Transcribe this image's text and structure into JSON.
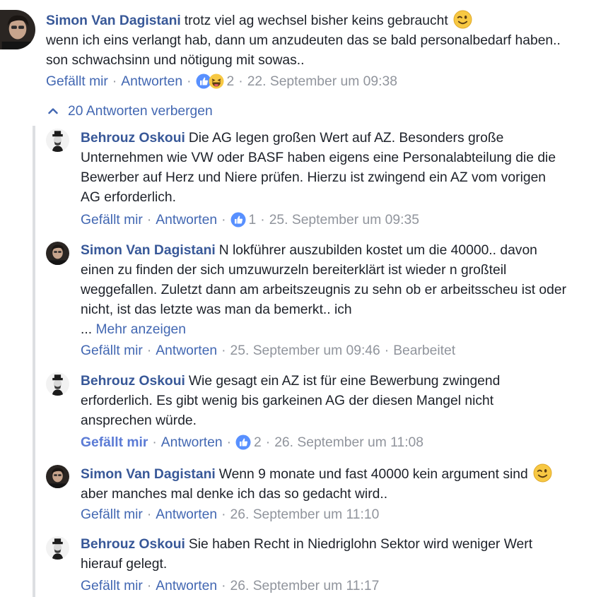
{
  "comments": [
    {
      "author": "Simon Van Dagistani",
      "text_part1": "trotz viel ag wechsel bisher keins gebraucht",
      "text_part2": "wenn ich eins verlangt hab, dann um anzudeuten das se bald personalbedarf haben.. son schwachsinn und nötigung mit sowas..",
      "like": "Gefällt mir",
      "reply": "Antworten",
      "reactions": "2",
      "time": "22. September um 09:38"
    }
  ],
  "toggle_replies": "20 Antworten verbergen",
  "replies": [
    {
      "author": "Behrouz Oskoui",
      "text": "Die AG legen großen Wert auf AZ. Besonders große Unternehmen wie VW oder BASF haben eigens eine Personalabteilung die die Bewerber auf Herz und Niere prüfen. Hierzu ist zwingend ein AZ vom vorigen AG erforderlich.",
      "like": "Gefällt mir",
      "reply": "Antworten",
      "reactions": "1",
      "time": "25. September um 09:35"
    },
    {
      "author": "Simon Van Dagistani",
      "text": "N lokführer auszubilden kostet um die 40000.. davon einen zu finden der sich umzuwurzeln bereiterklärt ist wieder n großteil weggefallen. Zuletzt dann am arbeitszeugnis zu sehn ob er arbeitsscheu ist oder nicht, ist das letzte was man da bemerkt.. ich",
      "ellipsis": "...",
      "more": "Mehr anzeigen",
      "like": "Gefällt mir",
      "reply": "Antworten",
      "time": "25. September um 09:46",
      "edited": "Bearbeitet"
    },
    {
      "author": "Behrouz Oskoui",
      "text": "Wie gesagt ein AZ ist für eine Bewerbung zwingend erforderlich. Es gibt wenig bis garkeinen AG der diesen Mangel nicht ansprechen würde.",
      "like": "Gefällt mir",
      "reply": "Antworten",
      "reactions": "2",
      "time": "26. September um 11:08"
    },
    {
      "author": "Simon Van Dagistani",
      "text_part1": "Wenn 9 monate und fast 40000 kein argument sind",
      "text_part2": "aber manches mal denke ich das so gedacht wird..",
      "like": "Gefällt mir",
      "reply": "Antworten",
      "time": "26. September um 11:10"
    },
    {
      "author": "Behrouz Oskoui",
      "text": "Sie haben Recht in Niedriglohn Sektor wird weniger Wert hierauf gelegt.",
      "like": "Gefällt mir",
      "reply": "Antworten",
      "time": "26. September um 11:17"
    }
  ],
  "colors": {
    "author": "#385898",
    "link": "#4267b2",
    "meta": "#90949c",
    "thread_line": "#dddfe2",
    "like_blue": "#5890ff"
  },
  "icons": [
    "wink-emoji-icon",
    "like-reaction-icon",
    "haha-reaction-icon",
    "chevron-up-icon"
  ]
}
